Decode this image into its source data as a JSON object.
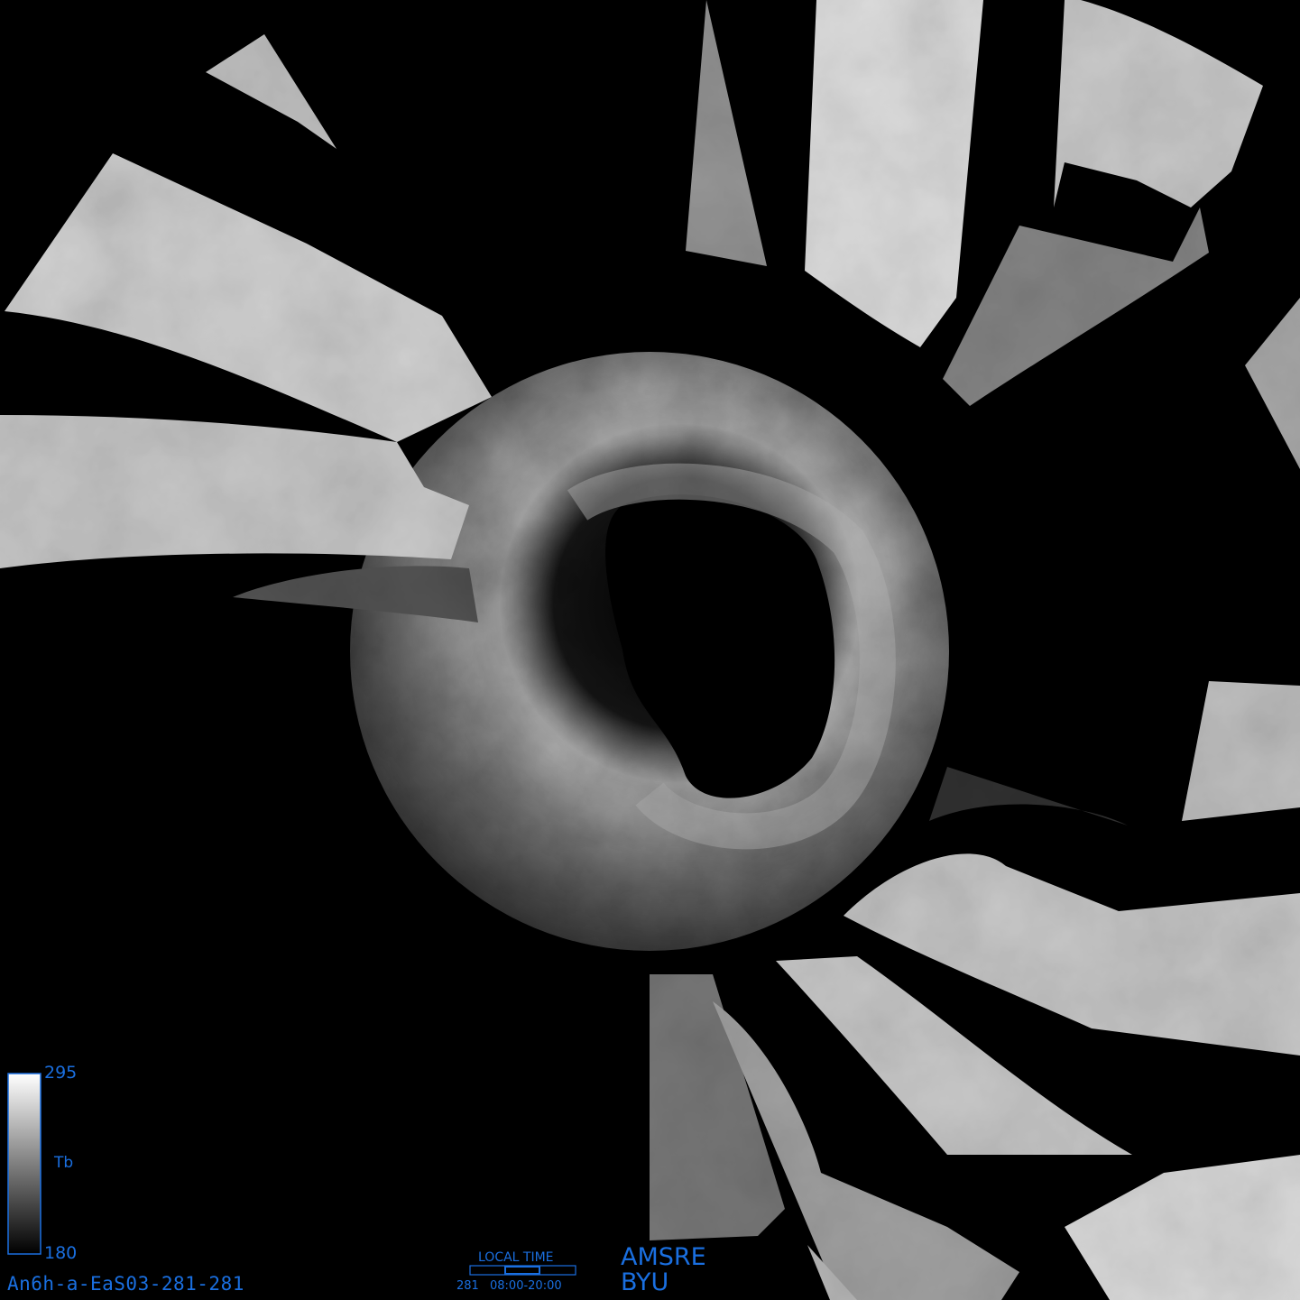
{
  "colors": {
    "background": "#000000",
    "annotation": "#1a6fe0",
    "scale_high": "#ffffff",
    "scale_low": "#000000"
  },
  "colorbar": {
    "max_label": "295",
    "mid_label": "Tb",
    "min_label": "180"
  },
  "product_id": "An6h-a-EaS03-281-281",
  "local_time": {
    "title": "LOCAL TIME",
    "day": "281",
    "range": "08:00-20:00"
  },
  "sensor": "AMSRE",
  "organization": "BYU"
}
